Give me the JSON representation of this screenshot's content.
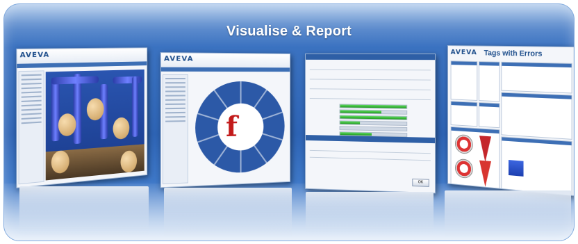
{
  "panel": {
    "title": "Visualise & Report"
  },
  "cards": {
    "viewer": {
      "logo": "AVEVA"
    },
    "portal": {
      "logo": "AVEVA"
    },
    "form": {
      "ok_label": "OK"
    },
    "dashboard": {
      "logo": "AVEVA",
      "title": "Tags with Errors"
    }
  },
  "colors": {
    "panel_top": "#5f94d6",
    "panel_mid": "#2d63b4",
    "title_text": "#ffffff",
    "accent_red": "#c21a1a",
    "progress_green": "#229a22"
  }
}
